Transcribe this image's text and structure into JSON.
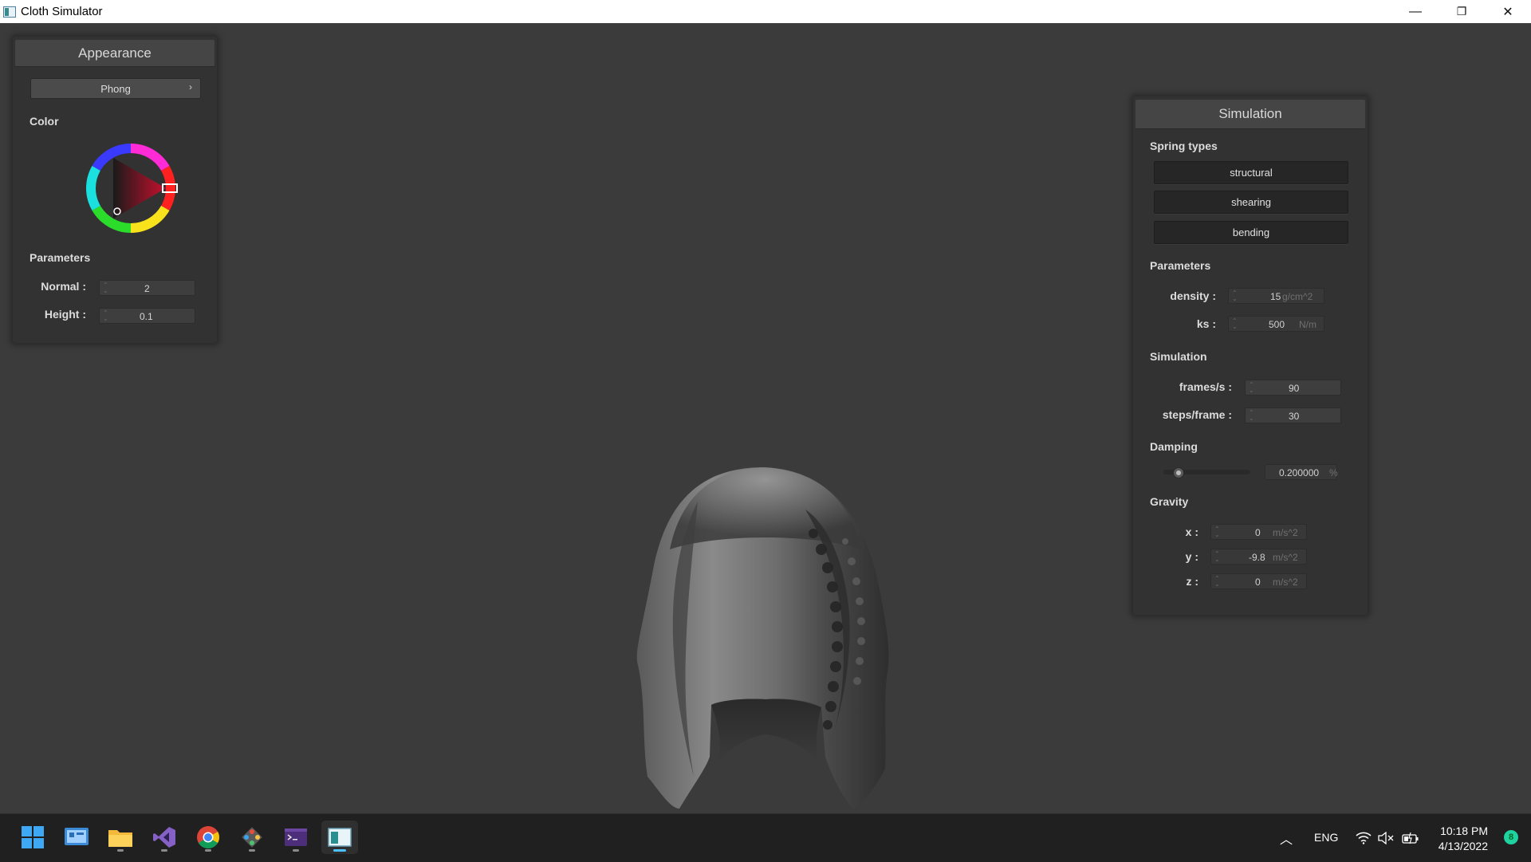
{
  "window": {
    "title": "Cloth Simulator",
    "controls": {
      "minimize": "—",
      "restore": "❐",
      "close": "✕"
    }
  },
  "appearance": {
    "header": "Appearance",
    "shading_select": "Phong",
    "color_label": "Color",
    "selected_color": "#c8102e",
    "parameters_label": "Parameters",
    "normal_label": "Normal :",
    "normal_value": "2",
    "height_label": "Height :",
    "height_value": "0.1"
  },
  "simulation": {
    "header": "Simulation",
    "spring_types_label": "Spring types",
    "springs": [
      "structural",
      "shearing",
      "bending"
    ],
    "parameters_label": "Parameters",
    "density_label": "density :",
    "density_value": "15",
    "density_unit": "g/cm^2",
    "ks_label": "ks :",
    "ks_value": "500",
    "ks_unit": "N/m",
    "simulation_label": "Simulation",
    "fps_label": "frames/s :",
    "fps_value": "90",
    "steps_label": "steps/frame :",
    "steps_value": "30",
    "damping_label": "Damping",
    "damping_value": "0.200000",
    "damping_unit": "%",
    "damping_slider_level": 0.2,
    "gravity_label": "Gravity",
    "gx_label": "x :",
    "gx_value": "0",
    "gx_unit": "m/s^2",
    "gy_label": "y :",
    "gy_value": "-9.8",
    "gy_unit": "m/s^2",
    "gz_label": "z :",
    "gz_value": "0",
    "gz_unit": "m/s^2"
  },
  "taskbar": {
    "apps": [
      "windows-start",
      "control-panel",
      "file-explorer",
      "visual-studio",
      "chrome",
      "git-tool",
      "terminal",
      "cloth-simulator"
    ],
    "language": "ENG",
    "time": "10:18 PM",
    "date": "4/13/2022",
    "notification_count": "8"
  }
}
